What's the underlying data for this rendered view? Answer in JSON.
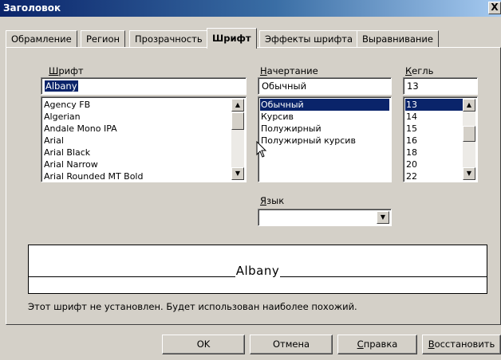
{
  "window": {
    "title": "Заголовок",
    "close_label": "X"
  },
  "tabs": [
    {
      "label": "Обрамление"
    },
    {
      "label": "Регион"
    },
    {
      "label": "Прозрачность"
    },
    {
      "label": "Шрифт",
      "active": true
    },
    {
      "label": "Эффекты шрифта"
    },
    {
      "label": "Выравнивание"
    }
  ],
  "font": {
    "label_u": "Ш",
    "label_rest": "рифт",
    "value": "Albany",
    "items": [
      "Agency FB",
      "Algerian",
      "Andale Mono IPA",
      "Arial",
      "Arial Black",
      "Arial Narrow",
      "Arial Rounded MT Bold"
    ]
  },
  "style": {
    "label_u": "Н",
    "label_rest": "ачертание",
    "value": "Обычный",
    "items": [
      "Обычный",
      "Курсив",
      "Полужирный",
      "Полужирный курсив"
    ],
    "selected": "Обычный"
  },
  "size": {
    "label_u": "К",
    "label_rest": "егль",
    "value": "13",
    "items": [
      "13",
      "14",
      "15",
      "16",
      "18",
      "20",
      "22"
    ],
    "selected": "13"
  },
  "language": {
    "label_u": "Я",
    "label_rest": "зык",
    "value": ""
  },
  "preview": {
    "text": "Albany"
  },
  "note": "Этот шрифт не установлен. Будет использован наиболее похожий.",
  "buttons": {
    "ok": "OK",
    "cancel": "Отмена",
    "help_u": "С",
    "help_rest": "правка",
    "reset_u": "В",
    "reset_rest": "осстановить"
  }
}
